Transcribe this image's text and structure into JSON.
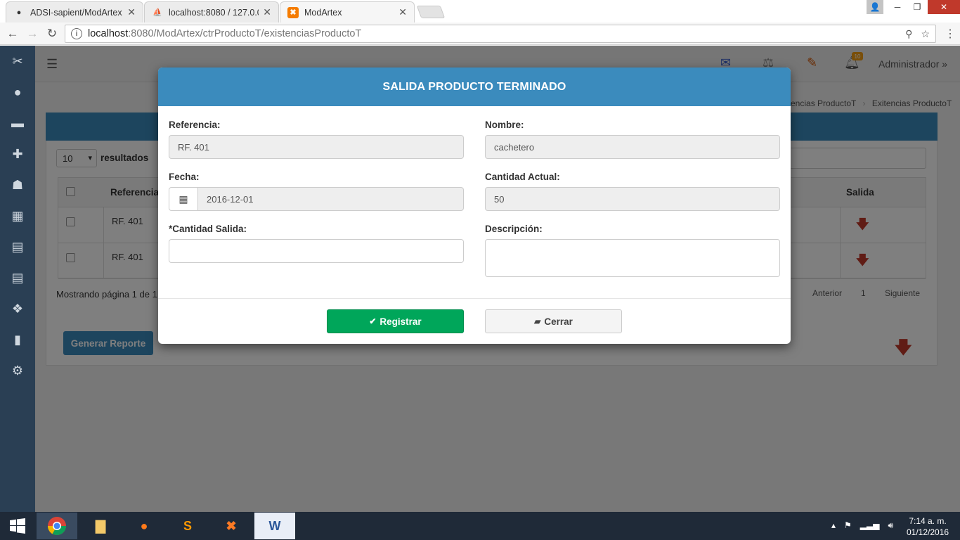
{
  "browser": {
    "tabs": [
      {
        "title": "ADSI-sapient/ModArtex",
        "icon": "github-icon"
      },
      {
        "title": "localhost:8080 / 127.0.0.1",
        "icon": "phpmyadmin-icon"
      },
      {
        "title": "ModArtex",
        "icon": "xampp-icon"
      }
    ],
    "tab_close": "✕",
    "url_host": "localhost",
    "url_path": ":8080/ModArtex/ctrProductoT/existenciasProductoT"
  },
  "app": {
    "user": "Administrador",
    "notification_count": "10",
    "breadcrumb": [
      "encias ProductoT",
      "Exitencias ProductoT"
    ],
    "page_length": "10",
    "page_length_label": "resultados",
    "table": {
      "headers": {
        "reference": "Referencia",
        "exit": "Salida"
      },
      "rows": [
        {
          "reference": "RF. 401"
        },
        {
          "reference": "RF. 401"
        }
      ]
    },
    "page_info": "Mostrando página 1 de 1",
    "pager": {
      "previous": "Anterior",
      "current": "1",
      "next": "Siguiente"
    },
    "report_button": "Generar Reporte"
  },
  "modal": {
    "title": "SALIDA PRODUCTO TERMINADO",
    "fields": {
      "referencia": {
        "label": "Referencia:",
        "value": "RF. 401"
      },
      "nombre": {
        "label": "Nombre:",
        "value": "cachetero"
      },
      "fecha": {
        "label": "Fecha:",
        "value": "2016-12-01"
      },
      "cantidad_actual": {
        "label": "Cantidad Actual:",
        "value": "50"
      },
      "cantidad_salida": {
        "label": "*Cantidad Salida:",
        "value": ""
      },
      "descripcion": {
        "label": "Descripción:",
        "value": ""
      }
    },
    "register_button": "Registrar",
    "close_button": "Cerrar"
  },
  "taskbar": {
    "time": "7:14 a. m.",
    "date": "01/12/2016"
  },
  "colors": {
    "accent": "#3b8bbd",
    "success": "#00a65a",
    "sidebar": "#2a3f54",
    "danger": "#c0392b"
  }
}
